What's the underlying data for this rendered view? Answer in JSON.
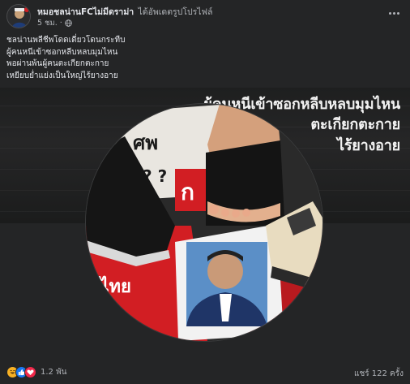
{
  "post": {
    "author": "หมอชลน่านFCไม่มีดราม่า",
    "action": "ได้อัพเดตรูปโปรไฟล์",
    "time": "5 ชม.",
    "privacy_icon": "globe-icon",
    "caption_lines": [
      "ชลน่านพลีชีพโดดเดี่ยวโดนกระทืบ",
      "ผู้คนหนีเข้าซอกหลีบหลบมุมไหน",
      "พอผ่านพ้นผู้คนตะเกียกตะกาย",
      "เหยียบย่ำแย่งเป็นใหญ่ไร้ยางอาย"
    ]
  },
  "cover": {
    "lines": [
      "ผู้คนหนีเข้าซอกหลีบหลบมุมไหน",
      "ตะเกียกตะกาย",
      "ไร้ยางอาย"
    ]
  },
  "profile_photo": {
    "sign_text": "ศพ",
    "question_marks": "? ?",
    "poster_text": "ก",
    "banner_text": "ลไทย"
  },
  "footer": {
    "reaction_icons": [
      "haha-icon",
      "like-icon",
      "love-icon"
    ],
    "reaction_count": "1.2 พัน",
    "share_count": "แชร์ 122 ครั้ง"
  },
  "colors": {
    "background": "#242526",
    "primary_text": "#e4e6eb",
    "secondary_text": "#b0b3b8",
    "banner_red": "#d21e23",
    "like_blue": "#1877f2"
  }
}
